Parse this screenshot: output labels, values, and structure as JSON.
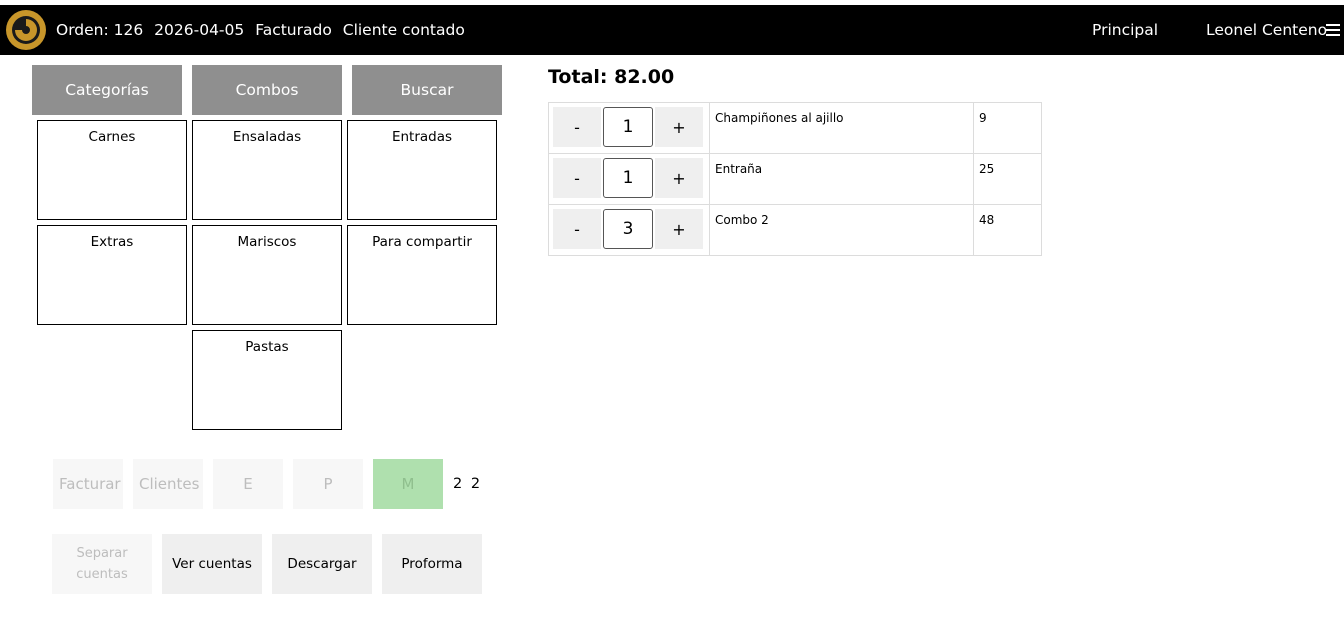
{
  "header": {
    "order_label": "Orden: 126",
    "date": "2026-04-05",
    "status": "Facturado",
    "client": "Cliente contado",
    "nav_principal": "Principal",
    "user_name": "Leonel Centeno",
    "logo_icon": "spiral-logo-icon",
    "menu_icon": "hamburger-menu-icon",
    "logo_color": "#c8962a"
  },
  "tabs": {
    "categorias": "Categorías",
    "combos": "Combos",
    "buscar": "Buscar"
  },
  "categories": [
    "Carnes",
    "Ensaladas",
    "Entradas",
    "Extras",
    "Mariscos",
    "Para compartir",
    "Pastas"
  ],
  "actions": {
    "facturar": "Facturar",
    "clientes": "Clientes",
    "e": "E",
    "p": "P",
    "m": "M",
    "pager": "2 2",
    "separar_line1": "Separar",
    "separar_line2": "cuentas",
    "ver_cuentas": "Ver cuentas",
    "descargar": "Descargar",
    "proforma": "Proforma"
  },
  "order": {
    "total_label": "Total: 82.00",
    "minus_label": "-",
    "plus_label": "+",
    "items": [
      {
        "qty": "1",
        "name": "Champiñones al ajillo",
        "price": "9"
      },
      {
        "qty": "1",
        "name": "Entraña",
        "price": "25"
      },
      {
        "qty": "3",
        "name": "Combo 2",
        "price": "48"
      }
    ]
  }
}
